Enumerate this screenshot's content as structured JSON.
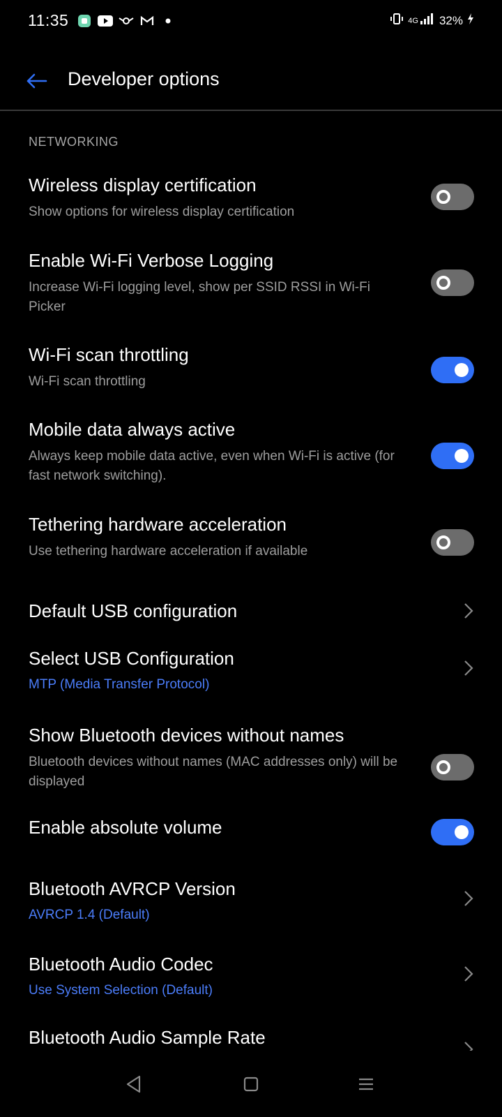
{
  "status_bar": {
    "time": "11:35",
    "network": "4G",
    "battery": "32%",
    "notification_icons": [
      "app-icon",
      "youtube-icon",
      "loop-icon",
      "gmail-icon",
      "dot-icon"
    ]
  },
  "app_bar": {
    "title": "Developer options",
    "back_icon": "arrow-left-icon"
  },
  "section_header": "NETWORKING",
  "settings": [
    {
      "title": "Wireless display certification",
      "subtitle": "Show options for wireless display certification",
      "control": "toggle",
      "checked": false
    },
    {
      "title": "Enable Wi-Fi Verbose Logging",
      "subtitle": "Increase Wi-Fi logging level, show per SSID RSSI in Wi-Fi Picker",
      "control": "toggle",
      "checked": false
    },
    {
      "title": "Wi-Fi scan throttling",
      "subtitle": "Wi-Fi scan throttling",
      "control": "toggle",
      "checked": true
    },
    {
      "title": "Mobile data always active",
      "subtitle": "Always keep mobile data active, even when Wi-Fi is active (for fast network switching).",
      "control": "toggle",
      "checked": true
    },
    {
      "title": "Tethering hardware acceleration",
      "subtitle": "Use tethering hardware acceleration if available",
      "control": "toggle",
      "checked": false
    },
    {
      "title": "Default USB configuration",
      "subtitle": "",
      "control": "chevron"
    },
    {
      "title": "Select USB Configuration",
      "subtitle": "MTP (Media Transfer Protocol)",
      "control": "chevron",
      "subtitle_accent": true
    },
    {
      "title": "Show Bluetooth devices without names",
      "subtitle": "Bluetooth devices without names (MAC addresses only) will be displayed",
      "control": "toggle",
      "checked": false
    },
    {
      "title": "Enable absolute volume",
      "subtitle": "",
      "control": "toggle",
      "checked": true
    },
    {
      "title": "Bluetooth AVRCP Version",
      "subtitle": "AVRCP 1.4 (Default)",
      "control": "chevron",
      "subtitle_accent": true
    },
    {
      "title": "Bluetooth Audio Codec",
      "subtitle": "Use System Selection (Default)",
      "control": "chevron",
      "subtitle_accent": true
    },
    {
      "title": "Bluetooth Audio Sample Rate",
      "subtitle": "",
      "control": "chevron"
    }
  ],
  "colors": {
    "accent": "#2f6ef5",
    "accent_text": "#4b7dfa",
    "background": "#000000",
    "toggle_off": "#6c6c6c"
  },
  "nav_bar": {
    "back_icon": "triangle-back-icon",
    "home_icon": "square-home-icon",
    "recents_icon": "menu-lines-icon"
  }
}
